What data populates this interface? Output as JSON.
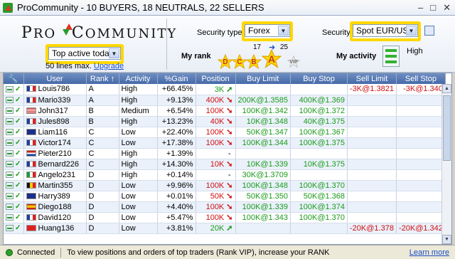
{
  "window": {
    "title": "ProCommunity - 10 BUYERS, 18 NEUTRALS, 22 SELLERS"
  },
  "logo": {
    "text_a": "P",
    "text_b": "RO",
    "text_c": "C",
    "text_d": "OMMUNITY"
  },
  "filter": {
    "selected": "Top active today",
    "note": "50 lines max.",
    "upgrade_link": "Upgrade"
  },
  "security_type": {
    "label": "Security type",
    "value": "Forex"
  },
  "security": {
    "label": "Security",
    "value": "Spot EUR/USD"
  },
  "rank": {
    "label": "My rank",
    "stars": [
      "D",
      "C",
      "B",
      "A",
      "VIP"
    ],
    "count_left": "17",
    "count_right": "25"
  },
  "activity": {
    "label": "My activity",
    "value": "High"
  },
  "table": {
    "columns": [
      "User",
      "Rank",
      "Activity",
      "%Gain",
      "Position",
      "Buy Limit",
      "Buy Stop",
      "Sell Limit",
      "Sell Stop"
    ],
    "rows": [
      {
        "flag": "fr",
        "user": "Louis786",
        "rank": "A",
        "activity": "High",
        "gain": "+66.45%",
        "position": "3K",
        "dir": "up",
        "buy_limit": "",
        "buy_stop": "",
        "sell_limit": "-3K@1.3821",
        "sell_stop": "-3K@1.340"
      },
      {
        "flag": "fr",
        "user": "Mario339",
        "rank": "A",
        "activity": "High",
        "gain": "+9.13%",
        "position": "400K",
        "dir": "down",
        "buy_limit": "200K@1.3585",
        "buy_stop": "400K@1.369",
        "sell_limit": "",
        "sell_stop": ""
      },
      {
        "flag": "us",
        "user": "John317",
        "rank": "B",
        "activity": "Medium",
        "gain": "+6.54%",
        "position": "100K",
        "dir": "down",
        "buy_limit": "100K@1.342",
        "buy_stop": "100K@1.372",
        "sell_limit": "",
        "sell_stop": ""
      },
      {
        "flag": "fr",
        "user": "Jules898",
        "rank": "B",
        "activity": "High",
        "gain": "+13.23%",
        "position": "40K",
        "dir": "down",
        "buy_limit": "10K@1.348",
        "buy_stop": "40K@1.375",
        "sell_limit": "",
        "sell_stop": ""
      },
      {
        "flag": "au",
        "user": "Liam116",
        "rank": "C",
        "activity": "Low",
        "gain": "+22.40%",
        "position": "100K",
        "dir": "down",
        "buy_limit": "50K@1.347",
        "buy_stop": "100K@1.367",
        "sell_limit": "",
        "sell_stop": ""
      },
      {
        "flag": "fr",
        "user": "Victor174",
        "rank": "C",
        "activity": "Low",
        "gain": "+17.38%",
        "position": "100K",
        "dir": "down",
        "buy_limit": "100K@1.344",
        "buy_stop": "100K@1.375",
        "sell_limit": "",
        "sell_stop": ""
      },
      {
        "flag": "nl",
        "user": "Pieter210",
        "rank": "C",
        "activity": "High",
        "gain": "+1.39%",
        "position": "-",
        "dir": "",
        "buy_limit": "",
        "buy_stop": "",
        "sell_limit": "",
        "sell_stop": ""
      },
      {
        "flag": "fr",
        "user": "Bernard226",
        "rank": "C",
        "activity": "High",
        "gain": "+14.30%",
        "position": "10K",
        "dir": "down",
        "buy_limit": "10K@1.339",
        "buy_stop": "10K@1.375",
        "sell_limit": "",
        "sell_stop": ""
      },
      {
        "flag": "it",
        "user": "Angelo231",
        "rank": "D",
        "activity": "High",
        "gain": "+0.14%",
        "position": "-",
        "dir": "",
        "buy_limit": "30K@1.3709",
        "buy_stop": "",
        "sell_limit": "",
        "sell_stop": ""
      },
      {
        "flag": "be",
        "user": "Martin355",
        "rank": "D",
        "activity": "Low",
        "gain": "+9.96%",
        "position": "100K",
        "dir": "down",
        "buy_limit": "100K@1.348",
        "buy_stop": "100K@1.370",
        "sell_limit": "",
        "sell_stop": ""
      },
      {
        "flag": "gb",
        "user": "Harry389",
        "rank": "D",
        "activity": "Low",
        "gain": "+0.01%",
        "position": "50K",
        "dir": "down",
        "buy_limit": "50K@1.350",
        "buy_stop": "50K@1.368",
        "sell_limit": "",
        "sell_stop": ""
      },
      {
        "flag": "es",
        "user": "Diego188",
        "rank": "D",
        "activity": "Low",
        "gain": "+4.40%",
        "position": "100K",
        "dir": "down",
        "buy_limit": "100K@1.339",
        "buy_stop": "100K@1.374",
        "sell_limit": "",
        "sell_stop": ""
      },
      {
        "flag": "fr",
        "user": "David120",
        "rank": "D",
        "activity": "Low",
        "gain": "+5.47%",
        "position": "100K",
        "dir": "down",
        "buy_limit": "100K@1.343",
        "buy_stop": "100K@1.370",
        "sell_limit": "",
        "sell_stop": ""
      },
      {
        "flag": "ch",
        "user": "Huang136",
        "rank": "D",
        "activity": "Low",
        "gain": "+3.81%",
        "position": "20K",
        "dir": "up",
        "buy_limit": "",
        "buy_stop": "",
        "sell_limit": "-20K@1.378",
        "sell_stop": "-20K@1.342"
      }
    ]
  },
  "status": {
    "connection": "Connected",
    "message": "To view positions and orders of top traders (Rank VIP), increase your RANK",
    "learn_more": "Learn more"
  },
  "colors": {
    "header_bg": "#4f72ad",
    "highlight": "#ffd800",
    "positive": "#1b9a1b",
    "negative": "#d01010"
  }
}
